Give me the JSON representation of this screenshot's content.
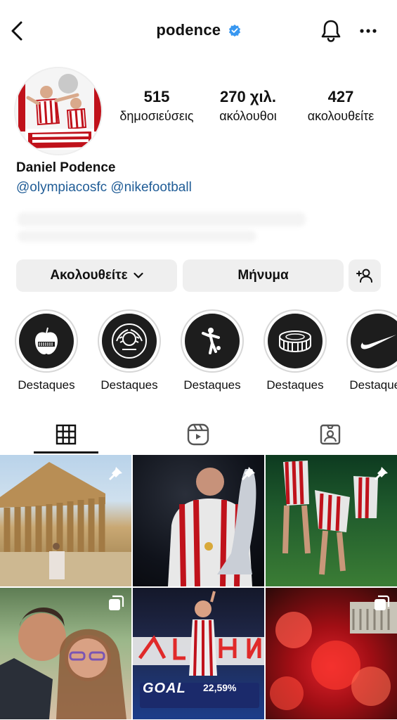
{
  "header": {
    "username": "podence",
    "icons": {
      "back": "chevron-left-icon",
      "verified": "verified-badge-icon",
      "notifications": "bell-icon",
      "more": "more-icon"
    }
  },
  "profile": {
    "name": "Daniel Podence",
    "bio_links": [
      "@olympiacosfc",
      "@nikefootball"
    ],
    "stats": [
      {
        "value": "515",
        "label": "δημοσιεύσεις"
      },
      {
        "value": "270 χιλ.",
        "label": "ακόλουθοι"
      },
      {
        "value": "427",
        "label": "ακολουθείτε"
      }
    ]
  },
  "actions": {
    "following_label": "Ακολουθείτε",
    "message_label": "Μήνυμα",
    "add_person_icon": "add-person-icon"
  },
  "highlights": [
    {
      "label": "Destaques",
      "icon": "apple-icon"
    },
    {
      "label": "Destaques",
      "icon": "olympiacos-crest-icon"
    },
    {
      "label": "Destaques",
      "icon": "player-icon"
    },
    {
      "label": "Destaques",
      "icon": "stadium-icon"
    },
    {
      "label": "Destaques",
      "icon": "nike-swoosh-icon"
    }
  ],
  "tabs": [
    {
      "name": "grid",
      "icon": "grid-icon",
      "active": true
    },
    {
      "name": "reels",
      "icon": "reels-icon",
      "active": false
    },
    {
      "name": "tagged",
      "icon": "tagged-icon",
      "active": false
    }
  ],
  "posts": [
    {
      "pinned": true,
      "multi": false
    },
    {
      "pinned": true,
      "multi": false
    },
    {
      "pinned": true,
      "multi": false
    },
    {
      "pinned": false,
      "multi": true
    },
    {
      "pinned": false,
      "multi": false,
      "overlay_goal": "GOAL",
      "overlay_pct": "22,59%"
    },
    {
      "pinned": false,
      "multi": true
    }
  ],
  "colors": {
    "link": "#1f5c96",
    "verified": "#3897f0",
    "button_bg": "#efefef"
  }
}
